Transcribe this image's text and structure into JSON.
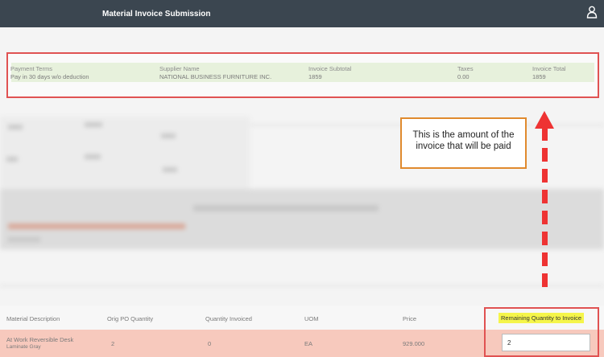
{
  "header": {
    "title": "Material Invoice Submission",
    "user_icon": "user-icon"
  },
  "summary": {
    "payment_terms": {
      "label": "Payment Terms",
      "value": "Pay in 30 days w/o deduction"
    },
    "supplier_name": {
      "label": "Supplier Name",
      "value": "NATIONAL BUSINESS FURNITURE INC."
    },
    "invoice_subtotal": {
      "label": "Invoice Subtotal",
      "value": "1859"
    },
    "taxes": {
      "label": "Taxes",
      "value": "0.00"
    },
    "invoice_total": {
      "label": "Invoice Total",
      "value": "1859"
    }
  },
  "callout": {
    "text": "This is the amount of the invoice that will be paid"
  },
  "table": {
    "headers": [
      "Material Description",
      "Orig PO Quantity",
      "Quantity Invoiced",
      "UOM",
      "Price",
      "Remaining Quantity to Invoice"
    ],
    "row": {
      "description_line1": "At Work Reversible Desk",
      "description_line2": "Laminate Gray",
      "orig_po_quantity": "2",
      "quantity_invoiced": "0",
      "uom": "EA",
      "price": "929.000",
      "remaining_quantity": "2"
    }
  },
  "colors": {
    "topbar": "#3b4650",
    "highlight_border": "#e05252",
    "row_highlight": "#f7c9bd",
    "label_highlight": "#f5f54a",
    "arrow": "#e33",
    "callout_border": "#e08a2e"
  }
}
